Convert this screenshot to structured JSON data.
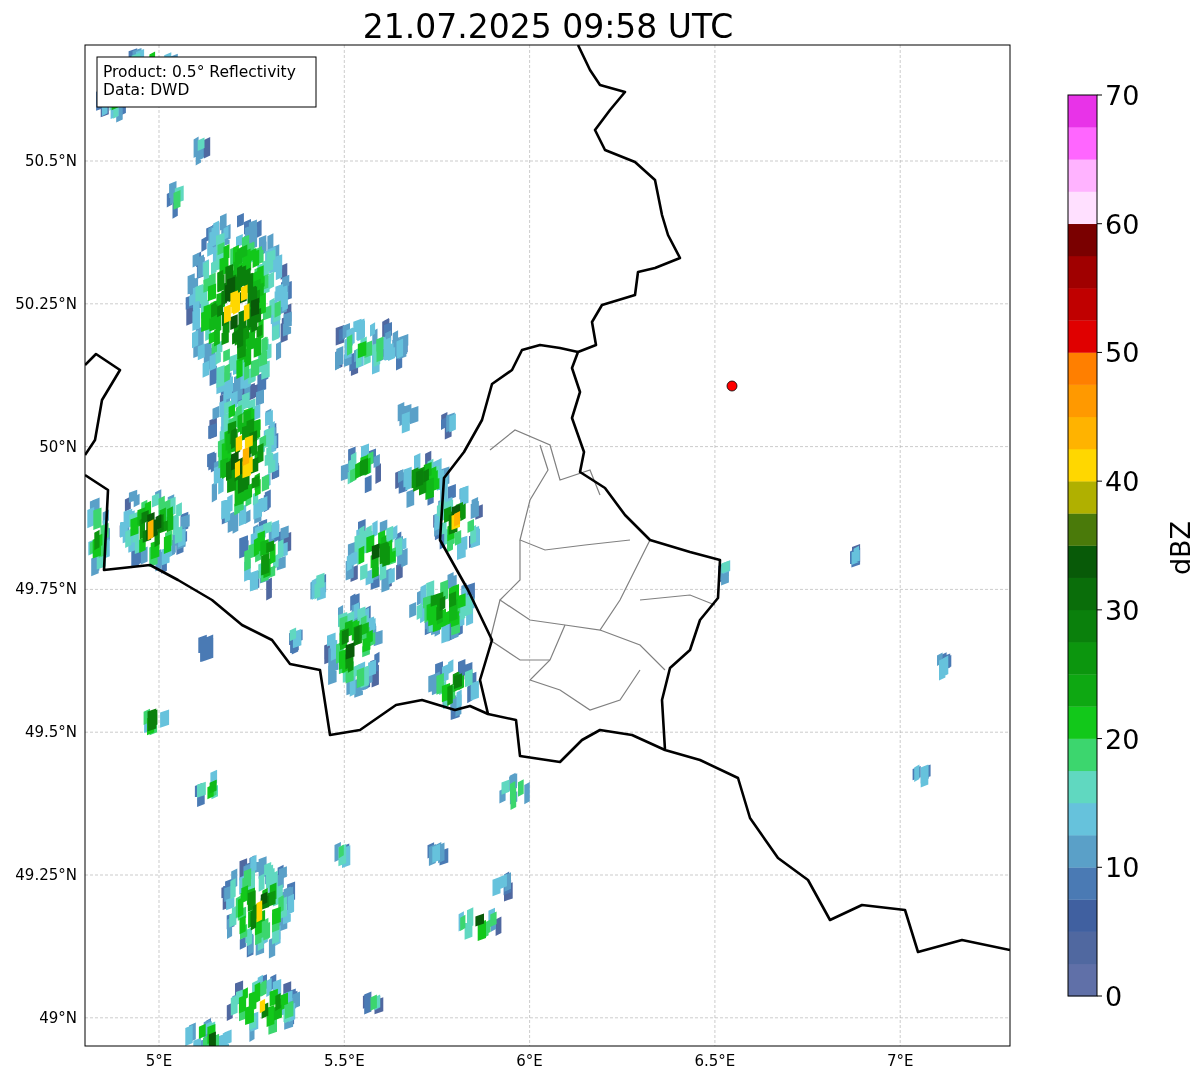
{
  "title": "21.07.2025 09:58 UTC",
  "info_box": {
    "lines": [
      "Product: 0.5° Reflectivity",
      "Data: DWD"
    ]
  },
  "map": {
    "yticks": [
      "50.5°N",
      "50.25°N",
      "50°N",
      "49.75°N",
      "49.5°N",
      "49.25°N",
      "49°N"
    ],
    "xticks": [
      "5°E",
      "5.5°E",
      "6°E",
      "6.5°E",
      "7°E"
    ]
  },
  "colorbar": {
    "label": "dBZ",
    "ticks": [
      "70",
      "60",
      "50",
      "40",
      "30",
      "20",
      "10",
      "0"
    ],
    "segments": [
      {
        "color": "#6070a8"
      },
      {
        "color": "#5068a0"
      },
      {
        "color": "#4060a0"
      },
      {
        "color": "#4a7ab4"
      },
      {
        "color": "#5aa0c8"
      },
      {
        "color": "#66c2dc"
      },
      {
        "color": "#60d8c0"
      },
      {
        "color": "#3cd66e"
      },
      {
        "color": "#12c81a"
      },
      {
        "color": "#0ea812"
      },
      {
        "color": "#0c960e"
      },
      {
        "color": "#0a800c"
      },
      {
        "color": "#0a6e0a"
      },
      {
        "color": "#085a08"
      },
      {
        "color": "#4a7a0a"
      },
      {
        "color": "#b0b000"
      },
      {
        "color": "#ffd700"
      },
      {
        "color": "#ffb300"
      },
      {
        "color": "#ff9900"
      },
      {
        "color": "#ff7f00"
      },
      {
        "color": "#e00000"
      },
      {
        "color": "#c00000"
      },
      {
        "color": "#a00000"
      },
      {
        "color": "#7a0000"
      },
      {
        "color": "#ffe0ff"
      },
      {
        "color": "#ffb3ff"
      },
      {
        "color": "#ff66ff"
      },
      {
        "color": "#e833e8"
      }
    ]
  }
}
